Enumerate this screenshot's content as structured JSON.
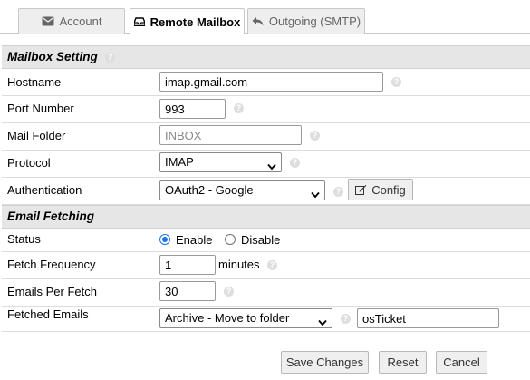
{
  "tabs": [
    {
      "label": "Account",
      "icon": "envelope-icon",
      "active": false
    },
    {
      "label": "Remote Mailbox",
      "icon": "inbox-icon",
      "active": true
    },
    {
      "label": "Outgoing (SMTP)",
      "icon": "reply-icon",
      "active": false
    }
  ],
  "sections": {
    "mailbox": "Mailbox Setting",
    "fetching": "Email Fetching"
  },
  "fields": {
    "hostname": {
      "label": "Hostname",
      "value": "imap.gmail.com"
    },
    "port": {
      "label": "Port Number",
      "value": "993"
    },
    "folder": {
      "label": "Mail Folder",
      "value": "",
      "placeholder": "INBOX"
    },
    "protocol": {
      "label": "Protocol",
      "selected": "IMAP"
    },
    "auth": {
      "label": "Authentication",
      "selected": "OAuth2 - Google",
      "config_label": "Config"
    },
    "status": {
      "label": "Status",
      "enable_label": "Enable",
      "disable_label": "Disable",
      "selected": "Enable"
    },
    "frequency": {
      "label": "Fetch Frequency",
      "value": "1",
      "unit": "minutes"
    },
    "per_fetch": {
      "label": "Emails Per Fetch",
      "value": "30"
    },
    "fetched": {
      "label": "Fetched Emails",
      "selected": "Archive - Move to folder",
      "folder_value": "osTicket"
    }
  },
  "actions": {
    "save": "Save Changes",
    "reset": "Reset",
    "cancel": "Cancel"
  },
  "colors": {
    "accent": "#1a73e8",
    "section_bg": "#e6e6e6",
    "tab_bg": "#eeeeee"
  }
}
